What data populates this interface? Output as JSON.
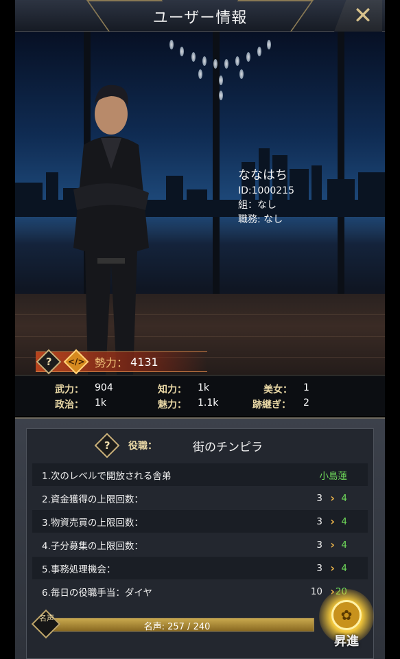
{
  "header": {
    "title": "ユーザー情報",
    "close_glyph": "✕"
  },
  "profile": {
    "name": "ななはち",
    "id": "ID:1000215",
    "group": "組：なし",
    "position": "職務: なし"
  },
  "power": {
    "label": "勢力：",
    "value": "4131",
    "help_glyph": "?"
  },
  "stats": [
    {
      "label": "武力：",
      "value": "904"
    },
    {
      "label": "知力：",
      "value": "1k"
    },
    {
      "label": "美女：",
      "value": "1"
    },
    {
      "label": "政治：",
      "value": "1k"
    },
    {
      "label": "魅力：",
      "value": "1.1k"
    },
    {
      "label": "跡継ぎ：",
      "value": "2"
    }
  ],
  "role": {
    "label": "役職：",
    "value": "街のチンピラ"
  },
  "perks": [
    {
      "label": "1.次のレベルで開放される舎弟",
      "reward": "小島蓮"
    },
    {
      "label": "2.資金獲得の上限回数：",
      "current": "3",
      "next": "4"
    },
    {
      "label": "3.物資売買の上限回数：",
      "current": "3",
      "next": "4"
    },
    {
      "label": "4.子分募集の上限回数：",
      "current": "3",
      "next": "4"
    },
    {
      "label": "5.事務処理機会：",
      "current": "3",
      "next": "4"
    },
    {
      "label": "6.毎日の役職手当：ダイヤ",
      "current": "10",
      "next": "20"
    }
  ],
  "fame": {
    "badge": "名声",
    "text": "名声: 257 / 240",
    "progress": 1.0
  },
  "promote": {
    "label": "昇進"
  },
  "colors": {
    "accent_gold": "#e8d7a5",
    "green": "#6fda5a",
    "power_orange": "#d66a2a"
  }
}
